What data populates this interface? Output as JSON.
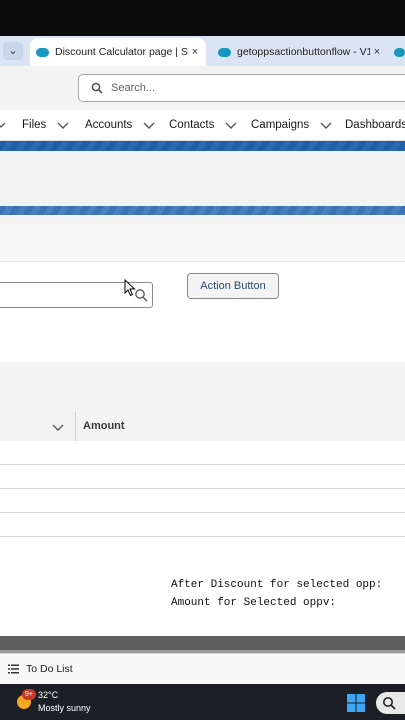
{
  "browser": {
    "tabs": [
      {
        "title": "Discount Calculator page | Sale",
        "active": true
      },
      {
        "title": "getoppsactionbuttonflow - V1",
        "active": false
      },
      {
        "title": "",
        "active": false
      }
    ],
    "close_glyph": "×",
    "tab_dropdown_glyph": "⌄"
  },
  "header": {
    "search_placeholder": "Search..."
  },
  "nav": {
    "items": [
      {
        "label": "Files"
      },
      {
        "label": "Accounts"
      },
      {
        "label": "Contacts"
      },
      {
        "label": "Campaigns"
      },
      {
        "label": "Dashboards"
      }
    ]
  },
  "main": {
    "action_button_label": "Action Button",
    "table": {
      "columns": [
        "",
        "Amount"
      ]
    },
    "after_discount_label": "After Discount for selected opp:",
    "amount_label": "Amount for Selected oppv:"
  },
  "utility_bar": {
    "todo_label": "To Do List"
  },
  "taskbar": {
    "notification_count": "9+",
    "temperature": "32°C",
    "condition": "Mostly sunny"
  },
  "colors": {
    "brand_blue": "#1f5fa8",
    "salesforce_cloud": "#1798c1"
  }
}
